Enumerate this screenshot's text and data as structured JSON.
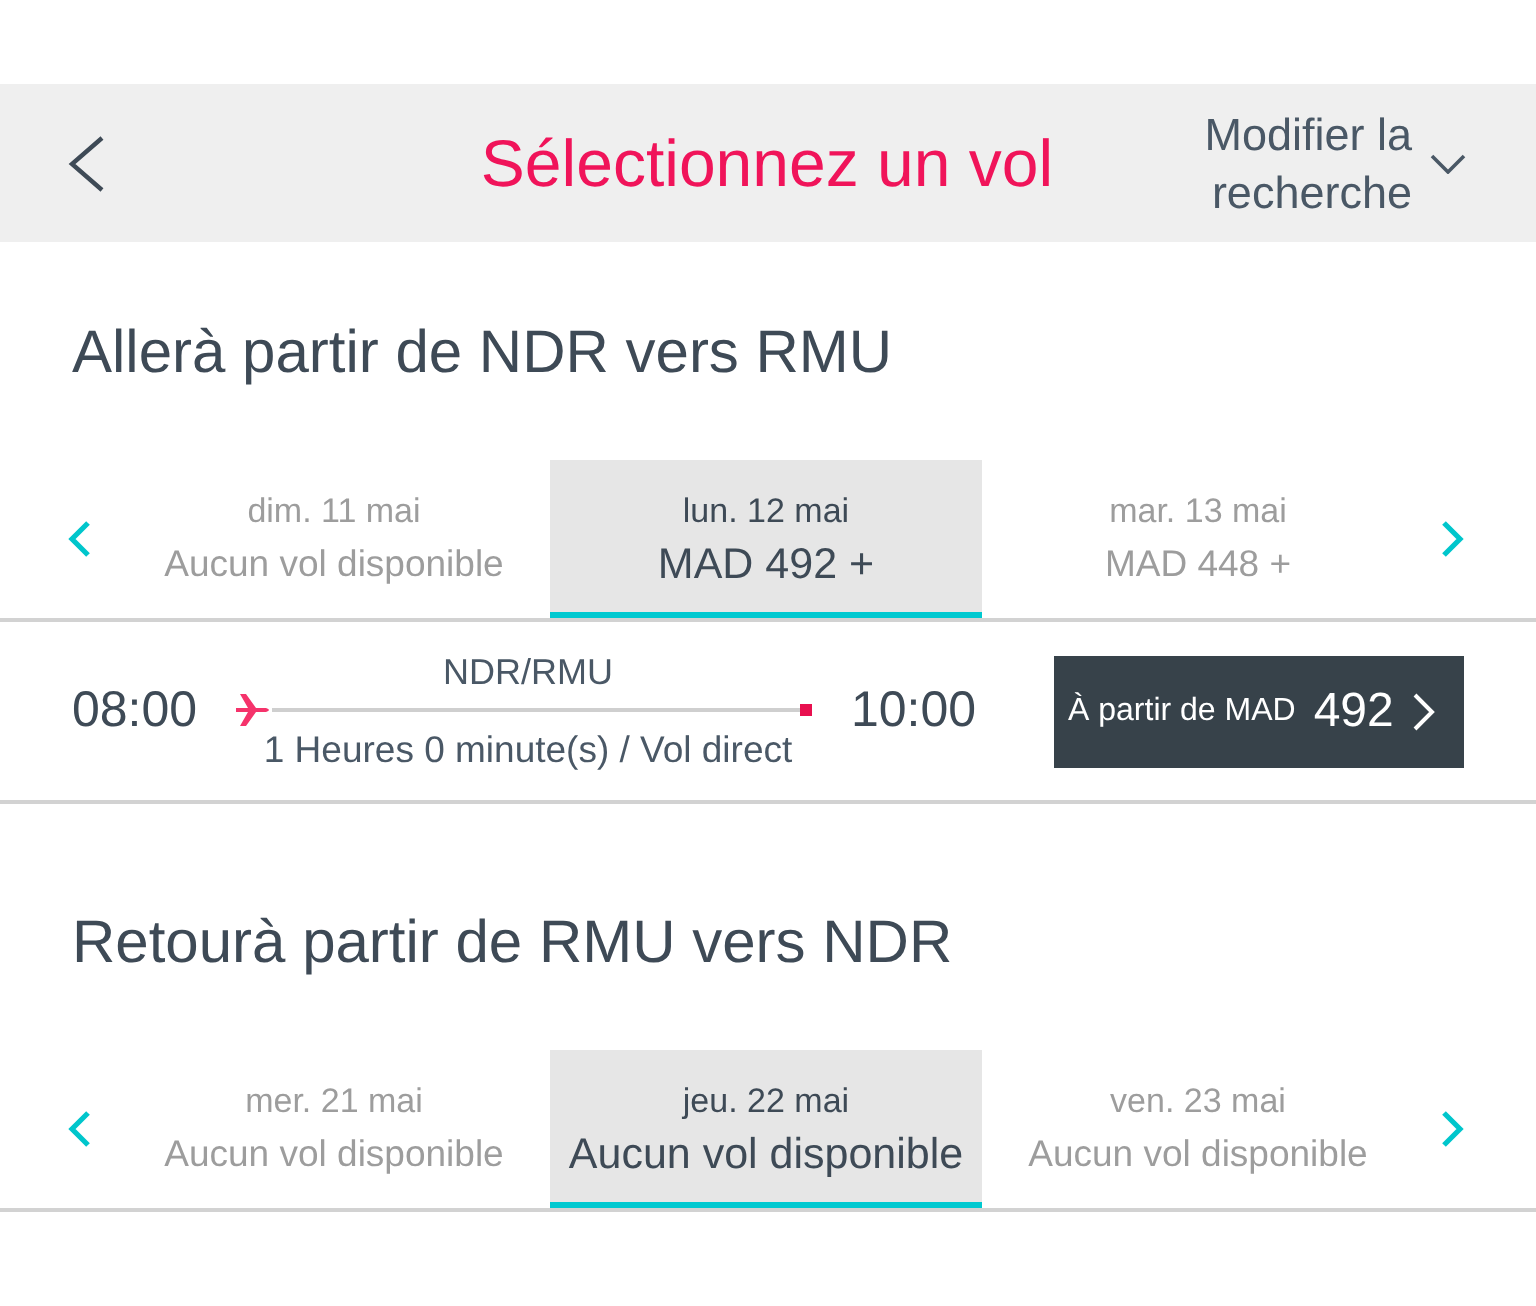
{
  "header": {
    "title": "Sélectionnez un vol",
    "modify_label": "Modifier la recherche"
  },
  "sections": [
    {
      "title": "Allerà partir de NDR vers RMU",
      "dates": [
        {
          "date": "dim. 11 mai",
          "price": "Aucun vol disponible",
          "selected": false
        },
        {
          "date": "lun. 12 mai",
          "price": "MAD 492 +",
          "selected": true
        },
        {
          "date": "mar. 13 mai",
          "price": "MAD 448 +",
          "selected": false
        }
      ],
      "flights": [
        {
          "departure": "08:00",
          "route": "NDR/RMU",
          "duration": "1 Heures 0 minute(s) / Vol direct",
          "arrival": "10:00",
          "price_prefix": "À partir de MAD",
          "price": "492"
        }
      ]
    },
    {
      "title": "Retourà partir de RMU vers NDR",
      "dates": [
        {
          "date": "mer. 21 mai",
          "price": "Aucun vol disponible",
          "selected": false
        },
        {
          "date": "jeu. 22 mai",
          "price": "Aucun vol disponible",
          "selected": true
        },
        {
          "date": "ven. 23 mai",
          "price": "Aucun vol disponible",
          "selected": false
        }
      ]
    }
  ]
}
